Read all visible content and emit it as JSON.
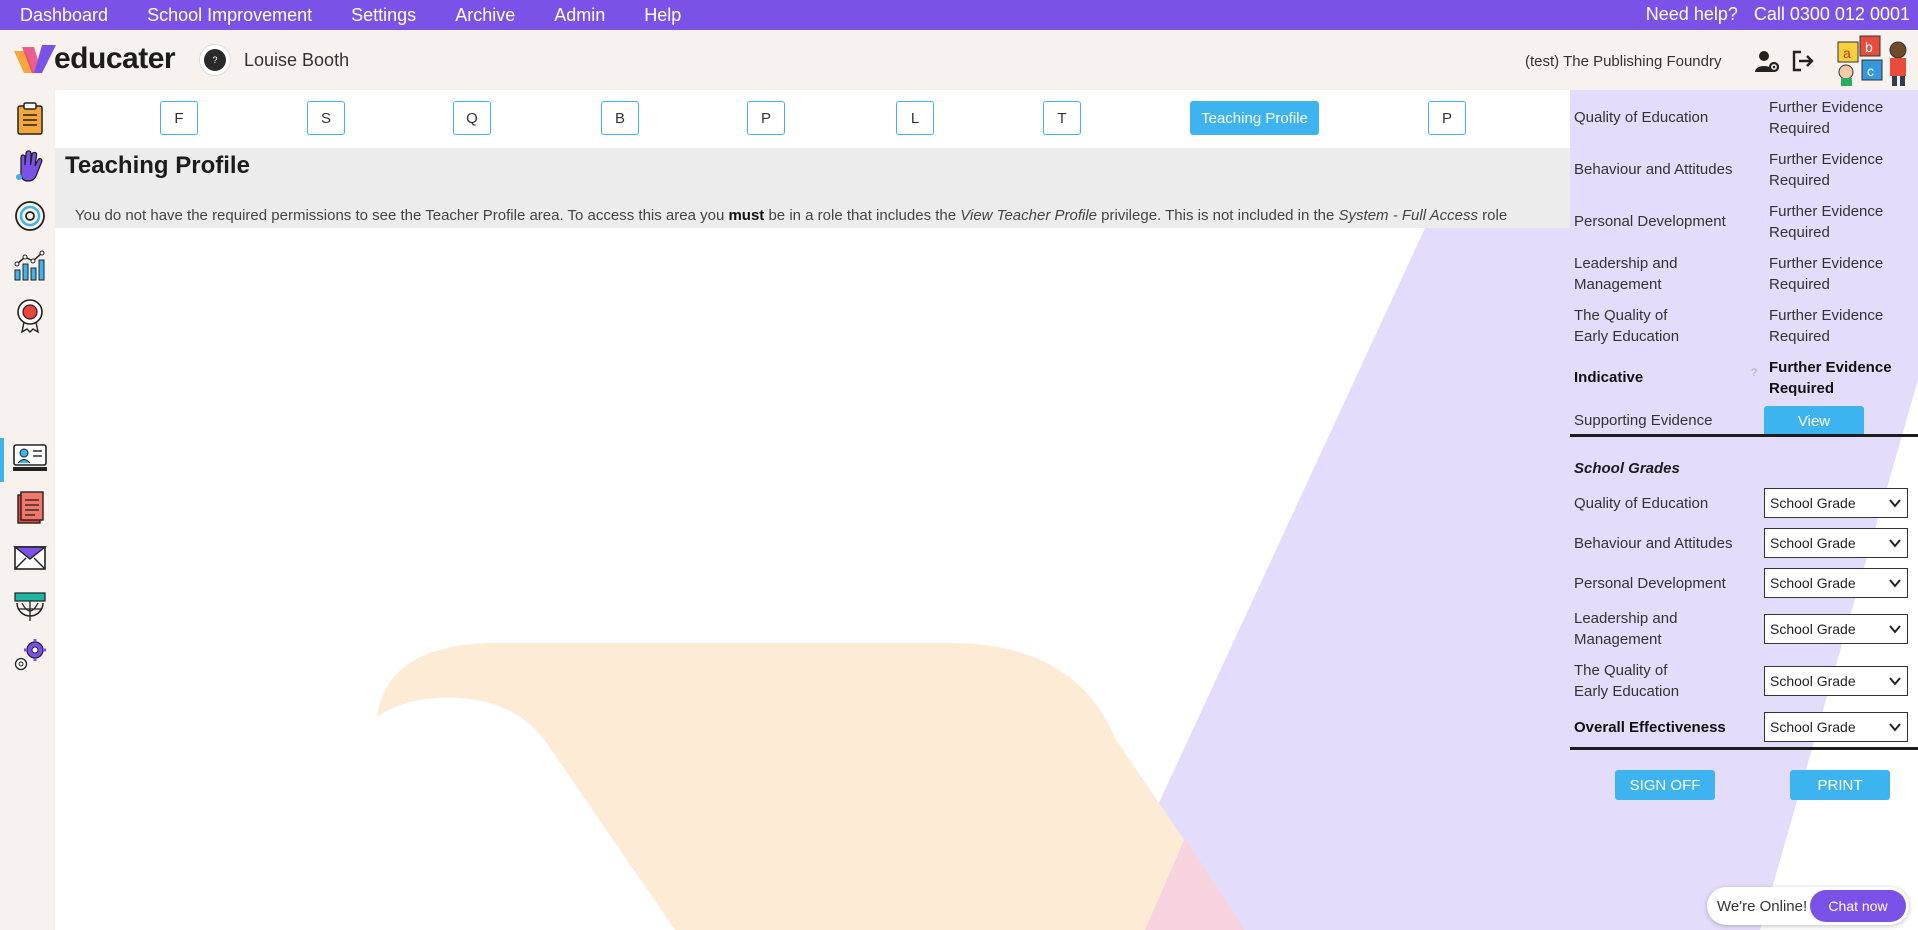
{
  "topnav": {
    "items": [
      "Dashboard",
      "School Improvement",
      "Settings",
      "Archive",
      "Admin",
      "Help"
    ],
    "need_help": "Need help?",
    "phone": "Call 0300 012 0001"
  },
  "header": {
    "logo_text": "educater",
    "avatar_text": "?",
    "username": "Louise Booth",
    "school_name": "(test) The Publishing Foundry"
  },
  "tabs": [
    "F",
    "S",
    "Q",
    "B",
    "P",
    "L",
    "T",
    "Teaching Profile",
    "P"
  ],
  "active_tab": "Teaching Profile",
  "profile": {
    "title": "Teaching Profile",
    "msg_part1": "You do not have the required permissions to see the Teacher Profile area. To access this area you ",
    "msg_bold": "must",
    "msg_part2": " be in a role that includes the ",
    "msg_italic1": "View Teacher Profile",
    "msg_part3": " privilege. This is not included in the ",
    "msg_italic2": "System - Full Access",
    "msg_part4": " role"
  },
  "judgements": [
    {
      "label": "Quality of Education",
      "value": "Further Evidence Required"
    },
    {
      "label": "Behaviour and Attitudes",
      "value": "Further Evidence Required"
    },
    {
      "label": "Personal Development",
      "value": "Further Evidence Required"
    },
    {
      "label": "Leadership and Management",
      "value": "Further Evidence Required"
    },
    {
      "label": "The Quality of Early Education",
      "value": "Further Evidence Required"
    }
  ],
  "indicative": {
    "label": "Indicative",
    "hint": "?",
    "value": "Further Evidence Required"
  },
  "supporting": {
    "label": "Supporting Evidence",
    "button": "View"
  },
  "grades": {
    "heading": "School Grades",
    "rows": [
      {
        "label": "Quality of Education",
        "value": "School Grade"
      },
      {
        "label": "Behaviour and Attitudes",
        "value": "School Grade"
      },
      {
        "label": "Personal Development",
        "value": "School Grade"
      },
      {
        "label": "Leadership and Management",
        "value": "School Grade"
      },
      {
        "label": "The Quality of Early Education",
        "value": "School Grade"
      }
    ],
    "overall": {
      "label": "Overall Effectiveness",
      "value": "School Grade"
    }
  },
  "actions": {
    "sign_off": "SIGN OFF",
    "print": "PRINT"
  },
  "chat": {
    "online": "We're Online!",
    "button": "Chat now"
  },
  "colors": {
    "brand_purple": "#7b52e8",
    "accent_blue": "#3db4ef",
    "panel_lilac": "#e4dcfb",
    "peach": "#fdebd6"
  }
}
